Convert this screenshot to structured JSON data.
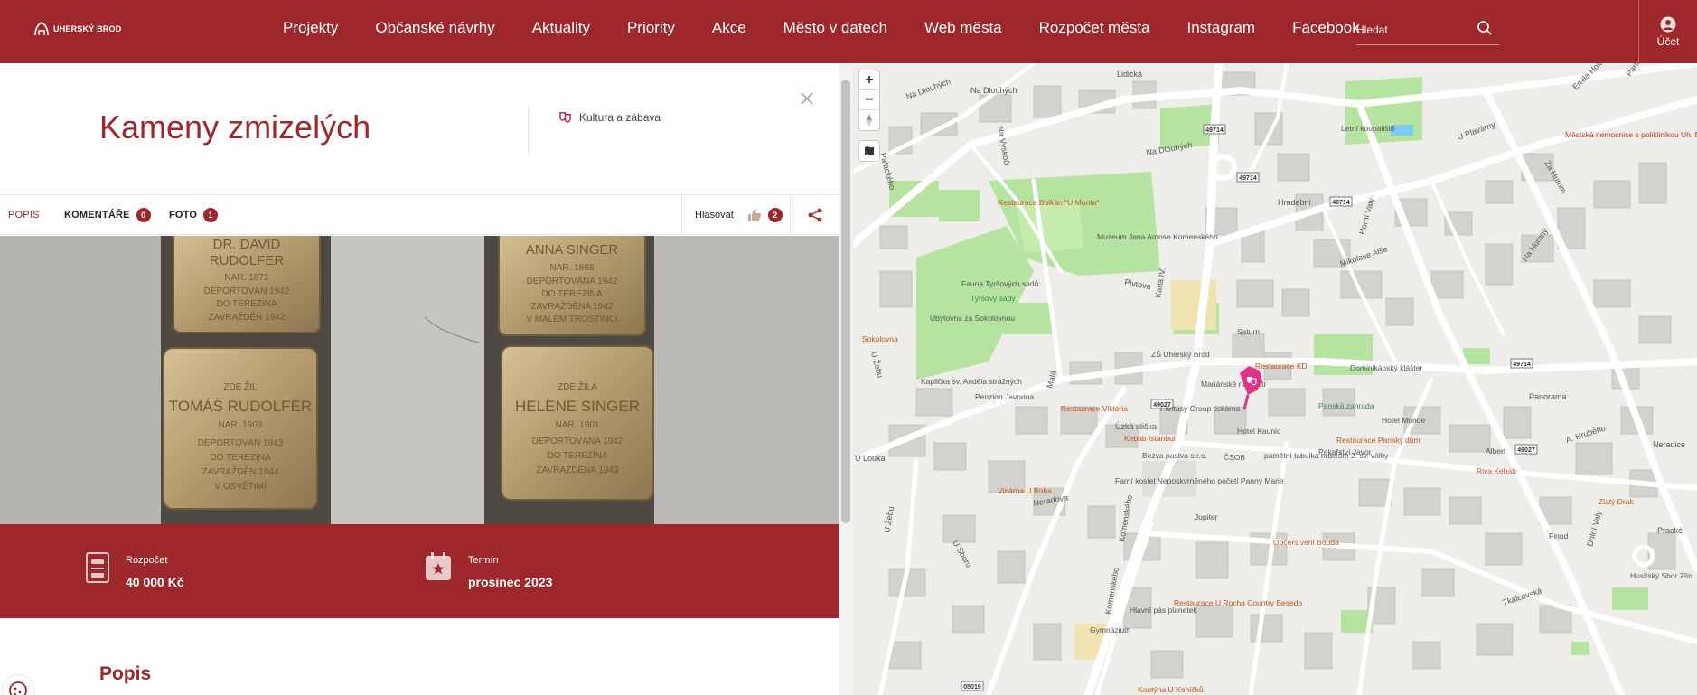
{
  "header": {
    "logo_text": "Uherský Brod",
    "nav": [
      "Projekty",
      "Občanské návrhy",
      "Aktuality",
      "Priority",
      "Akce",
      "Město v datech",
      "Web města",
      "Rozpočet města",
      "Instagram",
      "Facebook"
    ],
    "search_placeholder": "Hledat",
    "account_label": "Účet"
  },
  "detail": {
    "title": "Kameny zmizelých",
    "category": "Kultura a zábava",
    "tabs": [
      {
        "label": "Popis",
        "count": null,
        "active": true
      },
      {
        "label": "Komentáře",
        "count": "0",
        "active": false
      },
      {
        "label": "Foto",
        "count": "1",
        "active": false
      }
    ],
    "vote_label": "Hlasovat",
    "vote_count": "2",
    "photo_inscriptions": [
      [
        "DR. DAVID",
        "RUDOLFER",
        "NAR. 1871",
        "DEPORTOVÁN 1942",
        "DO TEREZÍNA",
        "ZAVRAŽDĚN 1942"
      ],
      [
        "ANNA SINGER",
        "NAR. 1868",
        "DEPORTOVÁNA 1942",
        "DO TEREZÍNA",
        "ZAVRAŽDĚNA 1942",
        "V MALÉM TROSTINCI"
      ],
      [
        "ZDE ŽIL",
        "TOMÁŠ RUDOLFER",
        "NAR. 1903",
        "DEPORTOVÁN 1943",
        "DO TEREZÍNA",
        "ZAVRAŽDĚN 1944",
        "V OSVĚTIMI"
      ],
      [
        "ZDE ŽILA",
        "HELENE SINGER",
        "NAR. 1901",
        "DEPORTOVÁNA 1942",
        "DO TEREZÍNA",
        "ZAVRAŽDĚNA 1943"
      ]
    ],
    "budget_label": "Rozpočet",
    "budget_value": "40 000 Kč",
    "term_label": "Termín",
    "term_value": "prosinec 2023",
    "section_title": "Popis"
  },
  "map": {
    "road_badges": [
      "49714",
      "49714",
      "49714",
      "49714",
      "49027",
      "49027",
      "05019"
    ],
    "street_labels": [
      "Na Dlouhých",
      "Na Dlouhých",
      "Lidická",
      "Na Vyskoči",
      "Palackého",
      "Na Dlouhých",
      "Hradební",
      "Mikolase Alše",
      "Karla IV.",
      "Pivtova",
      "Malá",
      "U Žebu",
      "U Žebu",
      "U Sboru",
      "Neradova",
      "Úzká ulička",
      "Komenského",
      "Komenského",
      "Tkalcovská",
      "Dolní Valy",
      "Horní Valy",
      "Na Humný",
      "Za Humny",
      "U Plavárny",
      "Panská",
      "Emila Holaše",
      "Panorama",
      "A. Hrubého",
      "Neradice",
      "Pracké",
      "U Louka"
    ],
    "poi_labels": [
      "Letní koupaliště",
      "Městská nemocnice s poliklinikou Uh. Brod",
      "Restaurace Balkán \"U Monta\"",
      "Muzeum Jana Amose Komenského",
      "Fauna Tyršových sadů",
      "Tyršovy sady",
      "Ubytovna za Sokolovnou",
      "Sokolovna",
      "Kaplička sv. Anděla strážných",
      "Saturn",
      "ZŠ Uherský Brod",
      "Dominikánský klášter",
      "Restaurace KD",
      "Mariánské náměstí",
      "Panská zahrada",
      "Penzion Javorina",
      "Restaurace Viktoria",
      "Fantasy Group tiskárna",
      "Hotel Kaunic",
      "Hotel Monde",
      "Kebab Istanbul",
      "Restaurace Panský dům",
      "Pekařství Javor",
      "Riva Kebab",
      "Albert",
      "Zlatý Drak",
      "Bezva pastva s.r.o.",
      "ČSOB",
      "pamětní tabulka hrdinům 2. sv. války",
      "Vinárna U Boba",
      "Farní kostel Neposkvrněného početí Panny Marie",
      "Jupiter",
      "Občerstvení Bouda",
      "Finod",
      "Restaurace U Rocha Country Beseda",
      "Hlavní pás planetek",
      "Gymnázium",
      "Kantýna U Koníčků",
      "Husitský Sbor Zlín"
    ]
  }
}
